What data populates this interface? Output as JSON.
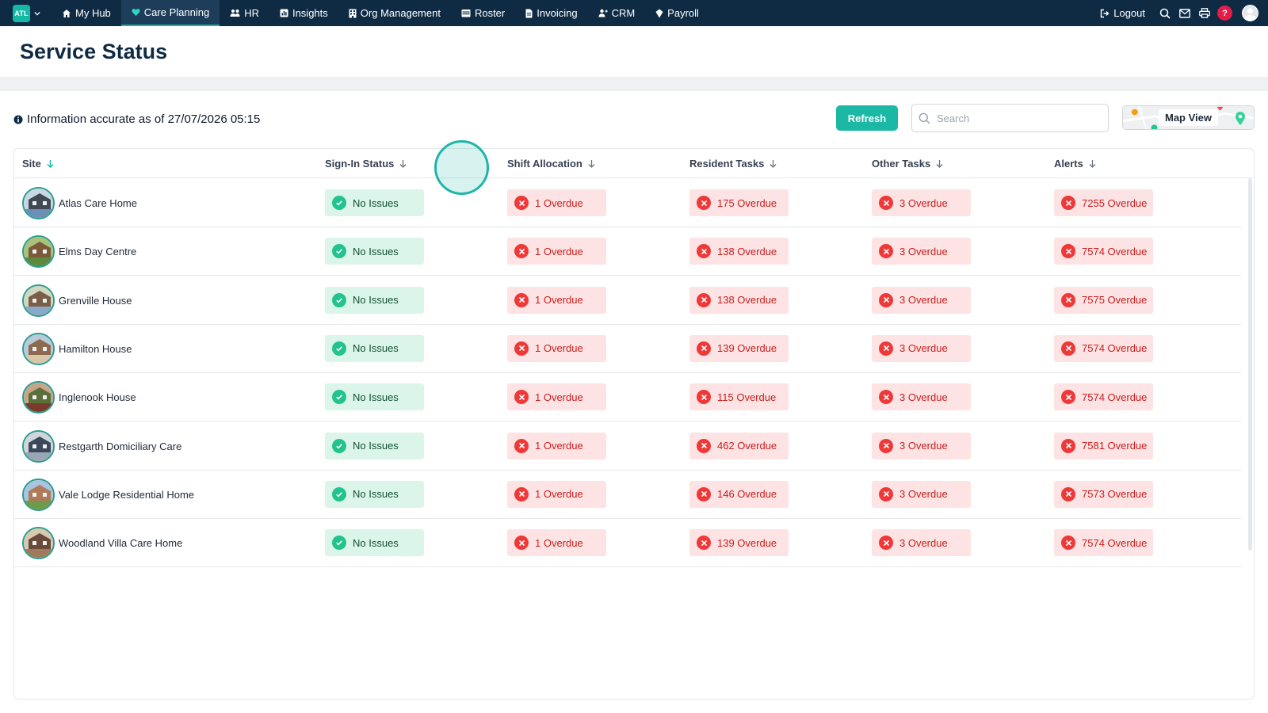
{
  "nav": {
    "brand": "ATL",
    "items": [
      {
        "label": "My Hub",
        "icon": "home-icon"
      },
      {
        "label": "Care Planning",
        "icon": "heart-icon",
        "active": true
      },
      {
        "label": "HR",
        "icon": "people-icon"
      },
      {
        "label": "Insights",
        "icon": "chart-icon"
      },
      {
        "label": "Org Management",
        "icon": "building-icon"
      },
      {
        "label": "Roster",
        "icon": "calendar-icon"
      },
      {
        "label": "Invoicing",
        "icon": "document-icon"
      },
      {
        "label": "CRM",
        "icon": "contacts-icon"
      },
      {
        "label": "Payroll",
        "icon": "payroll-icon"
      }
    ],
    "logout": "Logout",
    "help": "?"
  },
  "page": {
    "title": "Service Status",
    "info": "Information accurate as of 27/07/2026 05:15",
    "refresh": "Refresh",
    "search_placeholder": "Search",
    "map_view": "Map View"
  },
  "table": {
    "columns": [
      "Site",
      "Sign-In Status",
      "Shift Allocation",
      "Resident Tasks",
      "Other Tasks",
      "Alerts"
    ],
    "rows": [
      {
        "site": "Atlas Care Home",
        "signin": "No Issues",
        "shift": "1 Overdue",
        "resident": "175 Overdue",
        "other": "3 Overdue",
        "alerts": "7255 Overdue"
      },
      {
        "site": "Elms Day Centre",
        "signin": "No Issues",
        "shift": "1 Overdue",
        "resident": "138 Overdue",
        "other": "3 Overdue",
        "alerts": "7574 Overdue"
      },
      {
        "site": "Grenville House",
        "signin": "No Issues",
        "shift": "1 Overdue",
        "resident": "138 Overdue",
        "other": "3 Overdue",
        "alerts": "7575 Overdue"
      },
      {
        "site": "Hamilton House",
        "signin": "No Issues",
        "shift": "1 Overdue",
        "resident": "139 Overdue",
        "other": "3 Overdue",
        "alerts": "7574 Overdue"
      },
      {
        "site": "Inglenook House",
        "signin": "No Issues",
        "shift": "1 Overdue",
        "resident": "115 Overdue",
        "other": "3 Overdue",
        "alerts": "7574 Overdue"
      },
      {
        "site": "Restgarth Domiciliary Care",
        "signin": "No Issues",
        "shift": "1 Overdue",
        "resident": "462 Overdue",
        "other": "3 Overdue",
        "alerts": "7581 Overdue"
      },
      {
        "site": "Vale Lodge Residential Home",
        "signin": "No Issues",
        "shift": "1 Overdue",
        "resident": "146 Overdue",
        "other": "3 Overdue",
        "alerts": "7573 Overdue"
      },
      {
        "site": "Woodland Villa Care Home",
        "signin": "No Issues",
        "shift": "1 Overdue",
        "resident": "139 Overdue",
        "other": "3 Overdue",
        "alerts": "7574 Overdue"
      }
    ]
  },
  "colors": {
    "nav_bg": "#0f2b44",
    "accent": "#1bb8a5",
    "ok_bg": "#dcf5ea",
    "bad_bg": "#fde3e3",
    "bad_text": "#c81e1e"
  }
}
